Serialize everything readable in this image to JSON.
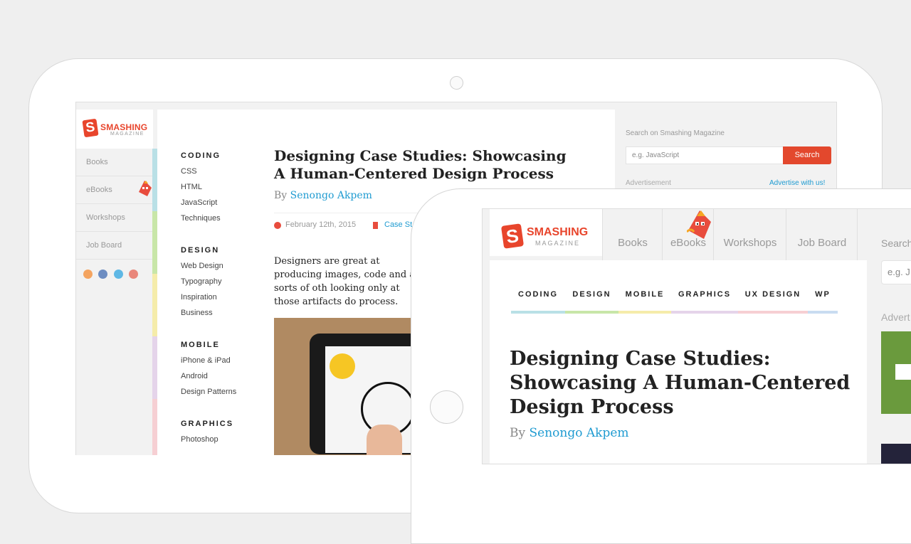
{
  "brand": {
    "name": "SMASHING",
    "sub": "MAGAZINE",
    "logo_letter": "S",
    "accent": "#e8452c",
    "link_color": "#1f9bd1"
  },
  "sidebar": {
    "items": [
      {
        "label": "Books"
      },
      {
        "label": "eBooks"
      },
      {
        "label": "Workshops"
      },
      {
        "label": "Job Board"
      }
    ],
    "social": [
      "rss-icon",
      "facebook-icon",
      "twitter-icon",
      "googleplus-icon"
    ]
  },
  "categories": {
    "coding": {
      "title": "CODING",
      "links": [
        "CSS",
        "HTML",
        "JavaScript",
        "Techniques"
      ]
    },
    "design": {
      "title": "DESIGN",
      "links": [
        "Web Design",
        "Typography",
        "Inspiration",
        "Business"
      ]
    },
    "mobile": {
      "title": "MOBILE",
      "links": [
        "iPhone & iPad",
        "Android",
        "Design Patterns"
      ]
    },
    "graphics": {
      "title": "GRAPHICS",
      "links": [
        "Photoshop"
      ]
    }
  },
  "article": {
    "title": "Designing Case Studies: Showcasing A Human-Centered Design Process",
    "by": "By",
    "author": "Senongo Akpem",
    "date": "February 12th, 2015",
    "tag": "Case St",
    "excerpt": "Designers are great at producing images, code and all sorts of oth looking only at those artifacts do process."
  },
  "search": {
    "label": "Search on Smashing Magazine",
    "placeholder": "e.g. JavaScript",
    "button": "Search",
    "advertisement": "Advertisement",
    "advertise_link": "Advertise with us!"
  },
  "small": {
    "tabs": [
      "Books",
      "eBooks",
      "Workshops",
      "Job Board"
    ],
    "categories": [
      {
        "label": "CODING",
        "color": "#b9e0e6"
      },
      {
        "label": "DESIGN",
        "color": "#c8e6a8"
      },
      {
        "label": "MOBILE",
        "color": "#f5ecaa"
      },
      {
        "label": "GRAPHICS",
        "color": "#e5d4ea"
      },
      {
        "label": "UX DESIGN",
        "color": "#f6cfd3"
      },
      {
        "label": "WP",
        "color": "#c9dcf1"
      }
    ],
    "search_partial": "Search",
    "input_partial": "e.g. J",
    "adv_partial": "Advert"
  }
}
